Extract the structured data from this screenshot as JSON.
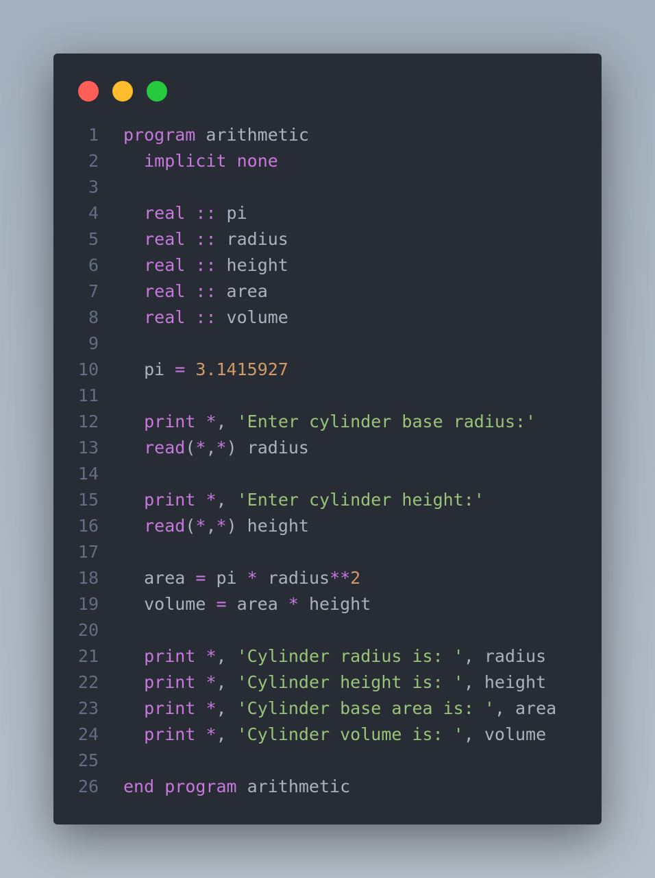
{
  "colors": {
    "background": "#a9b4c0",
    "window": "#282c34",
    "dot_red": "#ff5f56",
    "dot_yellow": "#ffbd2e",
    "dot_green": "#27c93f",
    "line_number": "#636d83",
    "keyword": "#c678dd",
    "plain": "#abb2bf",
    "string": "#98c379",
    "number": "#d19a66"
  },
  "window_controls": [
    "close",
    "minimize",
    "maximize"
  ],
  "code": {
    "language": "fortran",
    "lines": [
      {
        "n": "1",
        "tokens": [
          [
            "keyword",
            "program"
          ],
          [
            "plain",
            " arithmetic"
          ]
        ]
      },
      {
        "n": "2",
        "tokens": [
          [
            "plain",
            "  "
          ],
          [
            "keyword",
            "implicit"
          ],
          [
            "plain",
            " "
          ],
          [
            "keyword",
            "none"
          ]
        ]
      },
      {
        "n": "3",
        "tokens": []
      },
      {
        "n": "4",
        "tokens": [
          [
            "plain",
            "  "
          ],
          [
            "keyword",
            "real"
          ],
          [
            "plain",
            " "
          ],
          [
            "op",
            "::"
          ],
          [
            "plain",
            " pi"
          ]
        ]
      },
      {
        "n": "5",
        "tokens": [
          [
            "plain",
            "  "
          ],
          [
            "keyword",
            "real"
          ],
          [
            "plain",
            " "
          ],
          [
            "op",
            "::"
          ],
          [
            "plain",
            " radius"
          ]
        ]
      },
      {
        "n": "6",
        "tokens": [
          [
            "plain",
            "  "
          ],
          [
            "keyword",
            "real"
          ],
          [
            "plain",
            " "
          ],
          [
            "op",
            "::"
          ],
          [
            "plain",
            " height"
          ]
        ]
      },
      {
        "n": "7",
        "tokens": [
          [
            "plain",
            "  "
          ],
          [
            "keyword",
            "real"
          ],
          [
            "plain",
            " "
          ],
          [
            "op",
            "::"
          ],
          [
            "plain",
            " area"
          ]
        ]
      },
      {
        "n": "8",
        "tokens": [
          [
            "plain",
            "  "
          ],
          [
            "keyword",
            "real"
          ],
          [
            "plain",
            " "
          ],
          [
            "op",
            "::"
          ],
          [
            "plain",
            " volume"
          ]
        ]
      },
      {
        "n": "9",
        "tokens": []
      },
      {
        "n": "10",
        "tokens": [
          [
            "plain",
            "  pi "
          ],
          [
            "op",
            "="
          ],
          [
            "plain",
            " "
          ],
          [
            "number",
            "3.1415927"
          ]
        ]
      },
      {
        "n": "11",
        "tokens": []
      },
      {
        "n": "12",
        "tokens": [
          [
            "plain",
            "  "
          ],
          [
            "keyword",
            "print"
          ],
          [
            "plain",
            " "
          ],
          [
            "op",
            "*"
          ],
          [
            "plain",
            ", "
          ],
          [
            "string",
            "'Enter cylinder base radius:'"
          ]
        ]
      },
      {
        "n": "13",
        "tokens": [
          [
            "plain",
            "  "
          ],
          [
            "keyword",
            "read"
          ],
          [
            "plain",
            "("
          ],
          [
            "op",
            "*"
          ],
          [
            "plain",
            ","
          ],
          [
            "op",
            "*"
          ],
          [
            "plain",
            ") radius"
          ]
        ]
      },
      {
        "n": "14",
        "tokens": []
      },
      {
        "n": "15",
        "tokens": [
          [
            "plain",
            "  "
          ],
          [
            "keyword",
            "print"
          ],
          [
            "plain",
            " "
          ],
          [
            "op",
            "*"
          ],
          [
            "plain",
            ", "
          ],
          [
            "string",
            "'Enter cylinder height:'"
          ]
        ]
      },
      {
        "n": "16",
        "tokens": [
          [
            "plain",
            "  "
          ],
          [
            "keyword",
            "read"
          ],
          [
            "plain",
            "("
          ],
          [
            "op",
            "*"
          ],
          [
            "plain",
            ","
          ],
          [
            "op",
            "*"
          ],
          [
            "plain",
            ") height"
          ]
        ]
      },
      {
        "n": "17",
        "tokens": []
      },
      {
        "n": "18",
        "tokens": [
          [
            "plain",
            "  area "
          ],
          [
            "op",
            "="
          ],
          [
            "plain",
            " pi "
          ],
          [
            "op",
            "*"
          ],
          [
            "plain",
            " radius"
          ],
          [
            "op",
            "**"
          ],
          [
            "number",
            "2"
          ]
        ]
      },
      {
        "n": "19",
        "tokens": [
          [
            "plain",
            "  volume "
          ],
          [
            "op",
            "="
          ],
          [
            "plain",
            " area "
          ],
          [
            "op",
            "*"
          ],
          [
            "plain",
            " height"
          ]
        ]
      },
      {
        "n": "20",
        "tokens": []
      },
      {
        "n": "21",
        "tokens": [
          [
            "plain",
            "  "
          ],
          [
            "keyword",
            "print"
          ],
          [
            "plain",
            " "
          ],
          [
            "op",
            "*"
          ],
          [
            "plain",
            ", "
          ],
          [
            "string",
            "'Cylinder radius is: '"
          ],
          [
            "plain",
            ", radius"
          ]
        ]
      },
      {
        "n": "22",
        "tokens": [
          [
            "plain",
            "  "
          ],
          [
            "keyword",
            "print"
          ],
          [
            "plain",
            " "
          ],
          [
            "op",
            "*"
          ],
          [
            "plain",
            ", "
          ],
          [
            "string",
            "'Cylinder height is: '"
          ],
          [
            "plain",
            ", height"
          ]
        ]
      },
      {
        "n": "23",
        "tokens": [
          [
            "plain",
            "  "
          ],
          [
            "keyword",
            "print"
          ],
          [
            "plain",
            " "
          ],
          [
            "op",
            "*"
          ],
          [
            "plain",
            ", "
          ],
          [
            "string",
            "'Cylinder base area is: '"
          ],
          [
            "plain",
            ", area"
          ]
        ]
      },
      {
        "n": "24",
        "tokens": [
          [
            "plain",
            "  "
          ],
          [
            "keyword",
            "print"
          ],
          [
            "plain",
            " "
          ],
          [
            "op",
            "*"
          ],
          [
            "plain",
            ", "
          ],
          [
            "string",
            "'Cylinder volume is: '"
          ],
          [
            "plain",
            ", volume"
          ]
        ]
      },
      {
        "n": "25",
        "tokens": []
      },
      {
        "n": "26",
        "tokens": [
          [
            "keyword",
            "end"
          ],
          [
            "plain",
            " "
          ],
          [
            "keyword",
            "program"
          ],
          [
            "plain",
            " arithmetic"
          ]
        ]
      }
    ]
  }
}
